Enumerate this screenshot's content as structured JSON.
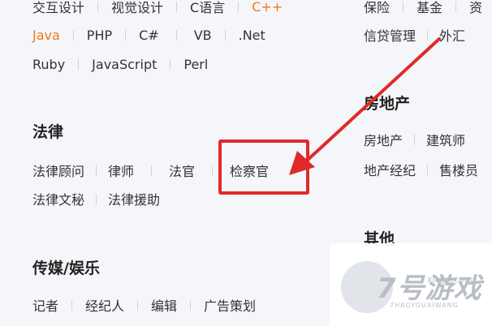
{
  "left": {
    "row0": [
      "交互设计",
      "视觉设计",
      "C语言",
      "C++"
    ],
    "row1": [
      "Java",
      "PHP",
      "C#",
      "VB",
      ".Net"
    ],
    "row2": [
      "Ruby",
      "JavaScript",
      "Perl"
    ],
    "law": {
      "title": "法律",
      "row1": [
        "法律顾问",
        "律师",
        "法官",
        "检察官"
      ],
      "row2": [
        "法律文秘",
        "法律援助"
      ]
    },
    "media": {
      "title": "传媒/娱乐",
      "row1": [
        "记者",
        "经纪人",
        "编辑",
        "广告策划"
      ]
    }
  },
  "right": {
    "row0": [
      "保险",
      "基金",
      "资"
    ],
    "row1": [
      "信贷管理",
      "外汇"
    ],
    "estate": {
      "title": "房地产",
      "row1": [
        "房地产",
        "建筑师"
      ],
      "row2": [
        "地产经纪",
        "售楼员"
      ]
    },
    "other": {
      "title": "其他"
    }
  },
  "highlight_color": "#e02a2a",
  "accent_color": "#f07b16",
  "watermark": {
    "brand": "7号游戏",
    "site": "xiayx.com",
    "pinyin": "7HAOYOUXIWANG"
  }
}
